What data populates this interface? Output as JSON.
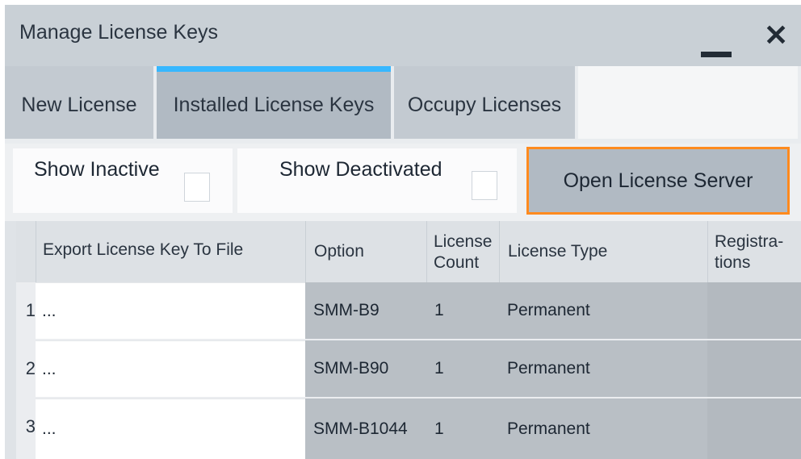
{
  "window": {
    "title": "Manage License Keys",
    "minimize_icon": "minimize-icon",
    "close_icon": "close-icon",
    "close_glyph": "✕"
  },
  "tabs": [
    {
      "label": "New License",
      "active": false
    },
    {
      "label": "Installed License Keys",
      "active": true
    },
    {
      "label": "Occupy Licenses",
      "active": false
    }
  ],
  "filters": {
    "show_inactive_label": "Show Inactive",
    "show_inactive_checked": false,
    "show_deactivated_label": "Show Deactivated",
    "show_deactivated_checked": false,
    "open_server_label": "Open License Server"
  },
  "table": {
    "columns": [
      {
        "label": "Export License Key To File"
      },
      {
        "label": "Option"
      },
      {
        "label_line1": "License",
        "label_line2": "Count"
      },
      {
        "label": "License Type"
      },
      {
        "label_line1": "Registra-",
        "label_line2": "tions"
      }
    ],
    "rows": [
      {
        "num": "1",
        "export": "...",
        "option": "SMM-B9",
        "count": "1",
        "type": "Permanent",
        "registrations": ""
      },
      {
        "num": "2",
        "export": "...",
        "option": "SMM-B90",
        "count": "1",
        "type": "Permanent",
        "registrations": ""
      },
      {
        "num": "3",
        "export": "...",
        "option": "SMM-B1044",
        "count": "1",
        "type": "Permanent",
        "registrations": ""
      }
    ]
  },
  "colors": {
    "accent_focus": "#ff8a1e",
    "tab_indicator": "#37b7ff"
  }
}
